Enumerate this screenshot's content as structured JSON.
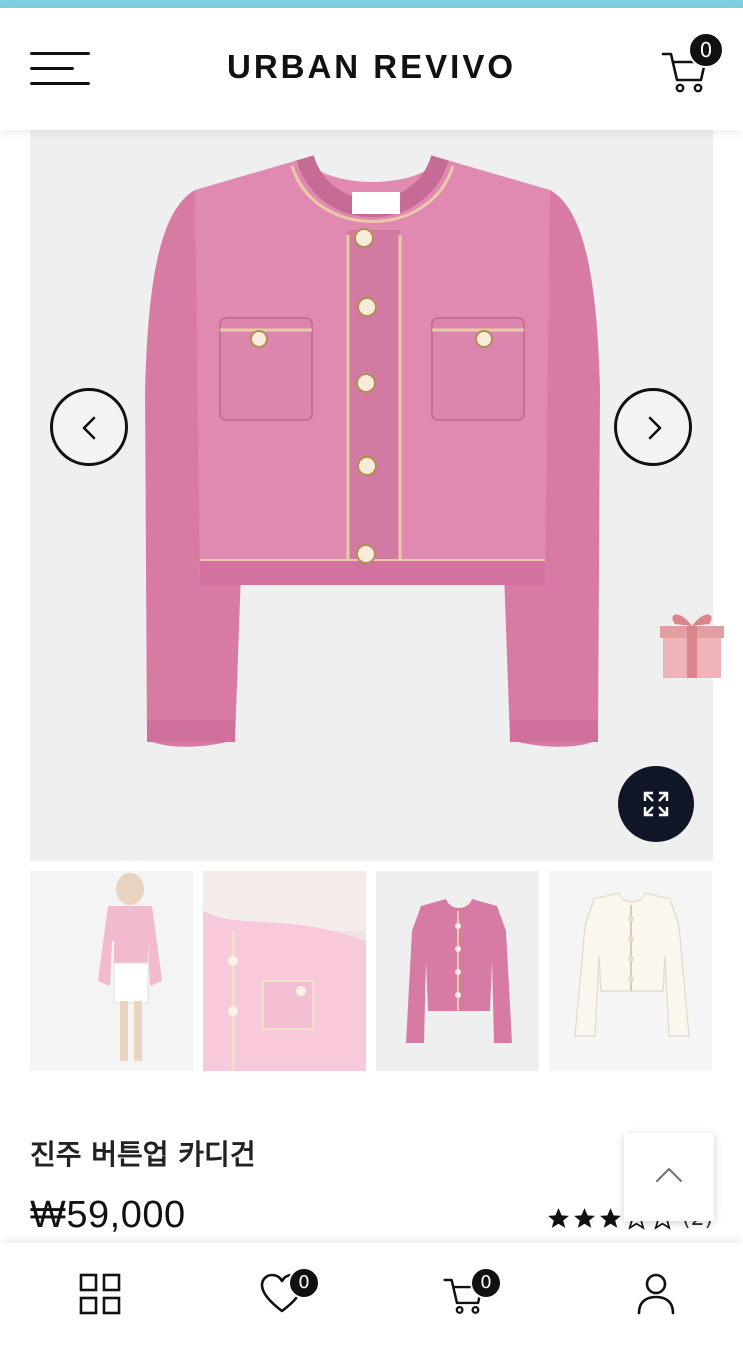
{
  "brand": {
    "name": "URBAN REVIVO"
  },
  "header": {
    "cart_count": "0"
  },
  "gallery": {
    "main_alt": "pink tweed pearl-button cardigan",
    "label_tag": "URBAN REVIVO",
    "thumbnails": [
      "model wearing cardigan",
      "cardigan detail close-up",
      "pink cardigan",
      "ivory cardigan"
    ]
  },
  "product": {
    "name": "진주 버튼업 카디건",
    "price": "₩59,000",
    "rating": {
      "value": 3,
      "max": 5,
      "count_label": "(2)"
    }
  },
  "bottom_nav": {
    "wishlist_count": "0",
    "cart_count": "0"
  },
  "colors": {
    "accent_bar": "#7ecfe0",
    "cardigan_pink": "#d97aa6",
    "zoom_button": "#0f1626",
    "badge": "#111111"
  },
  "icons": [
    "menu-icon",
    "cart-icon",
    "chevron-left-icon",
    "chevron-right-icon",
    "expand-icon",
    "gift-icon",
    "chevron-up-icon",
    "grid-icon",
    "heart-icon",
    "user-icon",
    "star-icon"
  ]
}
